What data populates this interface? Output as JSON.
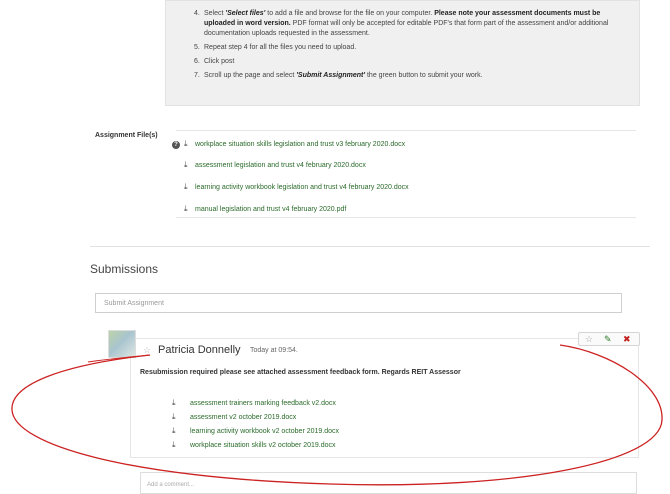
{
  "instructions": {
    "steps": [
      {
        "num": "4.",
        "pre": "Select ",
        "em": "'Select files'",
        "mid": " to add a file and browse for the file on your computer. ",
        "bold": "Please note your assessment documents must be uploaded in word version.",
        "post": " PDF format will only be accepted for editable PDF's that form part of the assessment and/or additional documentation uploads requested in the assessment."
      },
      {
        "num": "5.",
        "text": "Repeat step 4 for all the files you need to upload."
      },
      {
        "num": "6.",
        "text": "Click post"
      },
      {
        "num": "7.",
        "pre": "Scroll up the page and select ",
        "em": "'Submit Assignment'",
        "post": " the green button to submit your work."
      }
    ]
  },
  "assignment_files": {
    "label": "Assignment File(s)",
    "help_icon": "?",
    "files": [
      "workplace situation skills legislation and trust v3 february 2020.docx",
      "assessment legislation and trust v4 february 2020.docx",
      "learning activity workbook legislation and trust v4 february 2020.docx",
      "manual legislation and trust v4 february 2020.pdf"
    ]
  },
  "submissions": {
    "heading": "Submissions",
    "submit_placeholder": "Submit Assignment"
  },
  "post": {
    "author": "Patricia Donnelly",
    "timestamp": "Today at 09:54.",
    "text": "Resubmission required please see attached assessment feedback form. Regards REIT Assessor",
    "attachments": [
      "assessment trainers marking feedback v2.docx",
      "assessment v2 october 2019.docx",
      "learning activity workbook v2 october 2019.docx",
      "workplace situation skills v2 october 2019.docx"
    ],
    "actions": {
      "star": "☆",
      "edit": "✎",
      "hide": "✖"
    },
    "comment_placeholder": "Add a comment..."
  },
  "icons": {
    "download": "download-icon",
    "help": "question-circle-icon",
    "star": "star-icon",
    "edit": "pencil-icon",
    "hide": "eye-slash-icon"
  },
  "colors": {
    "link": "#2a6a2a",
    "annotation": "#cc2222",
    "panel_bg": "#f0f0f0"
  }
}
